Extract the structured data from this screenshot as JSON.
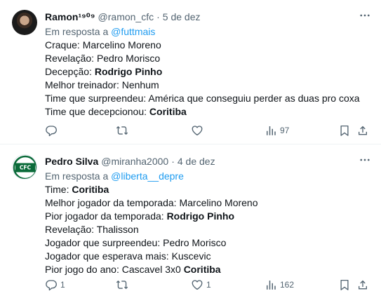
{
  "tweets": [
    {
      "name": "Ramon¹⁹⁰⁹",
      "handle": "@ramon_cfc",
      "sep": "·",
      "date": "5 de dez",
      "reply_prefix": "Em resposta a",
      "reply_to": "@futtmais",
      "lines": [
        {
          "label": "Craque: ",
          "value": "Marcelino Moreno",
          "bold": false
        },
        {
          "label": "Revelação: ",
          "value": "Pedro Morisco",
          "bold": false
        },
        {
          "label": "Decepção: ",
          "value": "Rodrigo Pinho",
          "bold": true
        },
        {
          "label": "Melhor treinador: ",
          "value": "Nenhum",
          "bold": false
        },
        {
          "label": "Time que surpreendeu: ",
          "value": "América que conseguiu perder as duas pro coxa",
          "bold": false
        },
        {
          "label": "Time que decepcionou: ",
          "value": "Coritiba",
          "bold": true
        }
      ],
      "replies": "",
      "retweets": "",
      "likes": "",
      "views": "97"
    },
    {
      "name": "Pedro Silva",
      "handle": "@miranha2000",
      "sep": "·",
      "date": "4 de dez",
      "reply_prefix": "Em resposta a",
      "reply_to": "@liberta__depre",
      "avatar_text": "CFC",
      "lines": [
        {
          "label": "Time: ",
          "value": "Coritiba",
          "bold": true
        },
        {
          "label": "Melhor jogador da temporada: ",
          "value": "Marcelino Moreno",
          "bold": false
        },
        {
          "label": "Pior jogador da temporada: ",
          "value": "Rodrigo Pinho",
          "bold": true
        },
        {
          "label": "Revelação: ",
          "value": "Thalisson",
          "bold": false
        },
        {
          "label": "Jogador que surpreendeu: ",
          "value": "Pedro Morisco",
          "bold": false
        },
        {
          "label": "Jogador que esperava mais: ",
          "value": "Kuscevic",
          "bold": false
        },
        {
          "label": "Pior jogo do ano: Cascavel 3x0 ",
          "value": "Coritiba",
          "bold": true
        }
      ],
      "replies": "1",
      "retweets": "",
      "likes": "1",
      "views": "162"
    }
  ],
  "icons": {
    "reply": "reply-icon",
    "retweet": "retweet-icon",
    "like": "heart-icon",
    "views": "views-icon",
    "bookmark": "bookmark-icon",
    "share": "share-icon",
    "more": "more-icon"
  },
  "colors": {
    "text": "#0f1419",
    "secondary": "#536471",
    "link": "#1d9bf0",
    "divider": "#eff3f4",
    "club_green": "#0b6b3a"
  }
}
